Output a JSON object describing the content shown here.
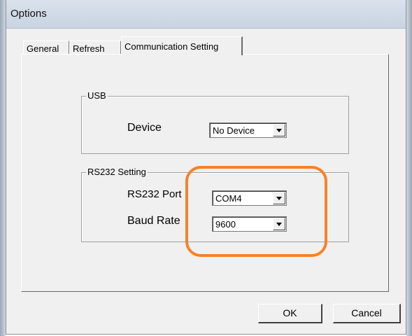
{
  "window": {
    "title": "Options"
  },
  "tabs": [
    {
      "label": "General"
    },
    {
      "label": "Refresh"
    },
    {
      "label": "Communication Setting",
      "selected": true
    }
  ],
  "usb_group": {
    "label": "USB",
    "device_label": "Device",
    "device_value": "No Device"
  },
  "rs232_group": {
    "label": "RS232 Setting",
    "port_label": "RS232 Port",
    "port_value": "COM4",
    "baud_label": "Baud Rate",
    "baud_value": "9600"
  },
  "buttons": {
    "ok": "OK",
    "cancel": "Cancel"
  },
  "colors": {
    "highlight": "#f5822a"
  }
}
